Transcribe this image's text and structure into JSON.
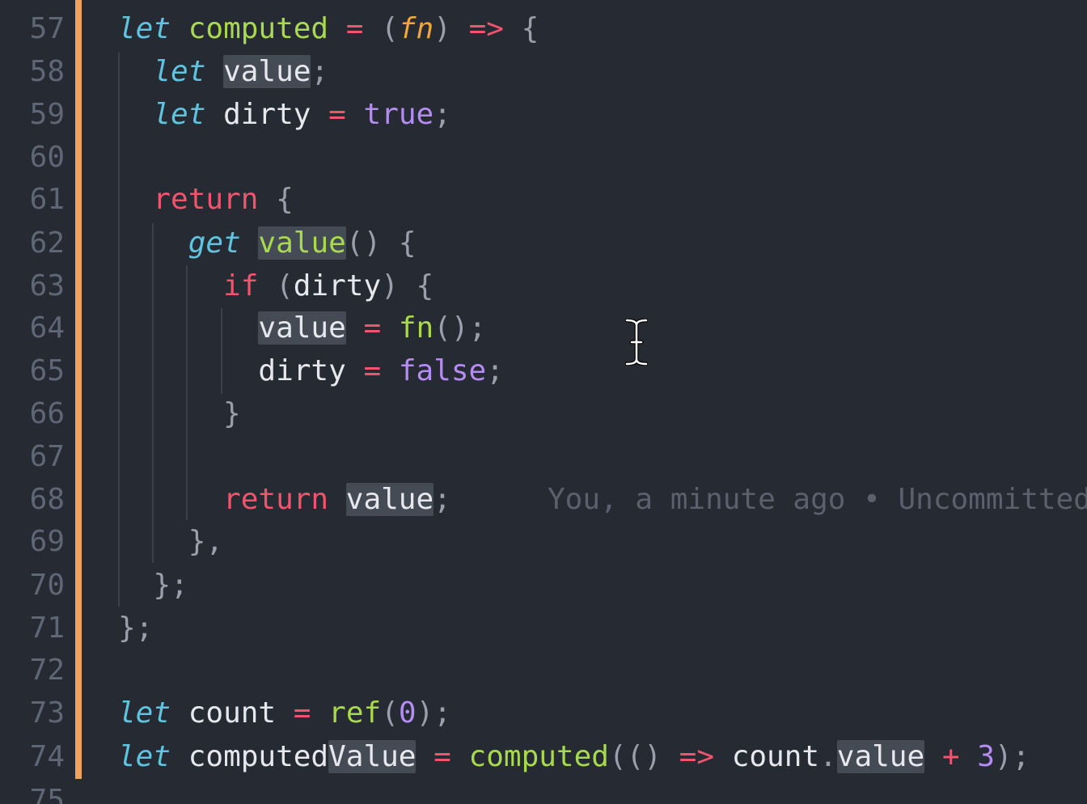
{
  "editor": {
    "line_numbers": [
      "57",
      "58",
      "59",
      "60",
      "61",
      "62",
      "63",
      "64",
      "65",
      "66",
      "67",
      "68",
      "69",
      "70",
      "71",
      "72",
      "73",
      "74",
      "75"
    ],
    "tokens": {
      "let": "let",
      "computed": "computed",
      "eq": "=",
      "lp": "(",
      "rp": ")",
      "fn": "fn",
      "arrow": "=>",
      "lbrace": "{",
      "rbrace": "}",
      "value": "value",
      "semi": ";",
      "dirty": "dirty",
      "true": "true",
      "false": "false",
      "return": "return",
      "get": "get",
      "parens": "()",
      "if": "if",
      "fn_call": "fn",
      "call_semi": "();",
      "close_comma": "},",
      "close_semi": "};",
      "count": "count",
      "ref": "ref",
      "zero": "0",
      "rp_semi": ");",
      "computedValue_prefix": "computed",
      "computedValue_suffix": "Value",
      "arrow_fn_open": "(()",
      "dot": ".",
      "plus": "+",
      "three": "3"
    },
    "blame": "You, a minute ago • Uncommitted changes"
  },
  "colors": {
    "background": "#262a33",
    "git_modified_bar": "#f0a45b",
    "keyword": "#5ec4e0",
    "control": "#f0556d",
    "function": "#a8d94e",
    "parameter": "#f3a53b",
    "constant": "#b48cf2",
    "selection_highlight": "#454b55"
  },
  "icons": {
    "cursor": "text-cursor-ibeam-icon"
  }
}
